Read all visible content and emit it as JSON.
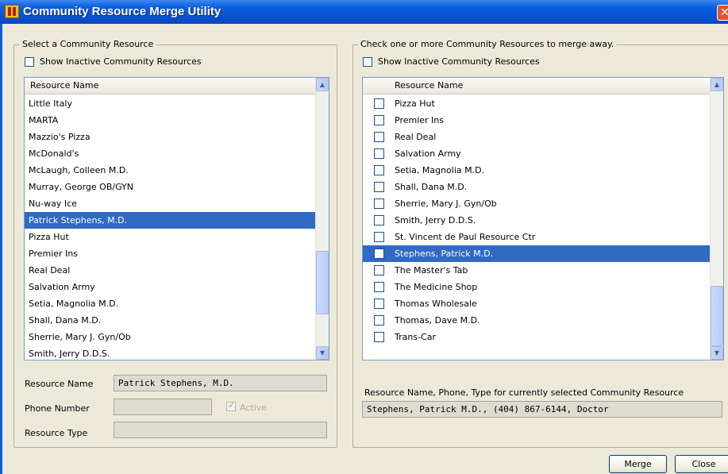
{
  "window": {
    "title": "Community Resource Merge Utility",
    "close_glyph": "✕",
    "icon": "app-icon"
  },
  "left": {
    "legend": "Select a Community Resource",
    "show_inactive_label": "Show Inactive Community Resources",
    "column_header": "Resource Name",
    "items": [
      "Little Italy",
      "MARTA",
      "Mazzio's Pizza",
      "McDonald's",
      "McLaugh, Colleen M.D.",
      "Murray, George OB/GYN",
      "Nu-way Ice",
      "Patrick Stephens, M.D.",
      "Pizza Hut",
      "Premier Ins",
      "Real Deal",
      "Salvation Army",
      "Setia, Magnolia M.D.",
      "Shall, Dana M.D.",
      "Sherrie, Mary J. Gyn/Ob",
      "Smith, Jerry D.D.S."
    ],
    "selected_index": 7,
    "resource_name_label": "Resource Name",
    "resource_name_value": "Patrick Stephens, M.D.",
    "phone_number_label": "Phone Number",
    "phone_number_value": "",
    "active_label": "Active",
    "resource_type_label": "Resource Type",
    "resource_type_value": ""
  },
  "right": {
    "legend": "Check one or more Community Resources to merge away.",
    "show_inactive_label": "Show Inactive Community Resources",
    "column_header": "Resource Name",
    "items": [
      "Pizza Hut",
      "Premier Ins",
      "Real Deal",
      "Salvation Army",
      "Setia, Magnolia M.D.",
      "Shall, Dana M.D.",
      "Sherrie, Mary J. Gyn/Ob",
      "Smith, Jerry D.D.S.",
      "St. Vincent de Paul Resource Ctr",
      "Stephens, Patrick M.D.",
      "The Master's Tab",
      "The Medicine Shop",
      "Thomas Wholesale",
      "Thomas, Dave M.D.",
      "Trans-Car"
    ],
    "selected_index": 9,
    "info_label": "Resource Name, Phone, Type for currently selected Community Resource",
    "info_value": "Stephens, Patrick M.D., (404) 867-6144, Doctor"
  },
  "buttons": {
    "merge": "Merge",
    "close": "Close"
  },
  "scroll": {
    "up_glyph": "▲",
    "down_glyph": "▼"
  },
  "colors": {
    "selection": "#316ac5",
    "titlebar": "#0a5fe0",
    "face": "#ece9d8"
  }
}
